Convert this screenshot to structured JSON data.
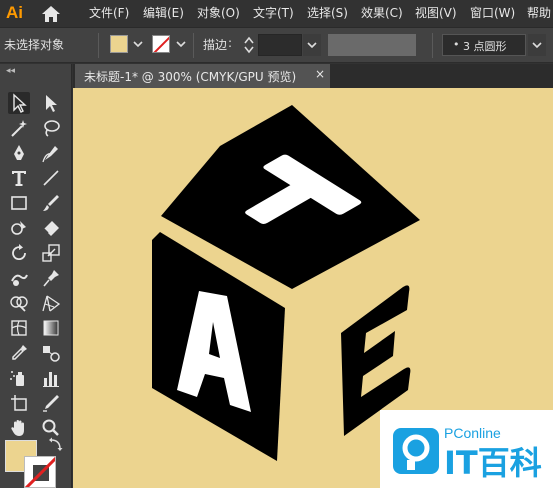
{
  "app": {
    "logo": "Ai",
    "home_icon": "home-icon"
  },
  "menu": [
    {
      "label": "文件(F)"
    },
    {
      "label": "编辑(E)"
    },
    {
      "label": "对象(O)"
    },
    {
      "label": "文字(T)"
    },
    {
      "label": "选择(S)"
    },
    {
      "label": "效果(C)"
    },
    {
      "label": "视图(V)"
    },
    {
      "label": "窗口(W)"
    },
    {
      "label": "帮助"
    }
  ],
  "control_bar": {
    "selection_status": "未选择对象",
    "fill_color": "#ecd48f",
    "stroke_label": "描边",
    "stroke_value": "",
    "brush_label": "3 点圆形"
  },
  "tools_panel": {
    "collapse_label": "◂◂",
    "fill_color": "#ecd48f",
    "stroke_color": "none"
  },
  "document": {
    "tab_title": "未标题-1* @ 300% (CMYK/GPU 预览)",
    "close_label": "×",
    "canvas_color": "#ecd48f"
  },
  "artwork": {
    "cube_color": "#000000",
    "letter_color": "#ffffff",
    "letters": {
      "top": "T",
      "left": "A",
      "right": "E"
    }
  },
  "watermark": {
    "brand_small": "PConline",
    "brand_large": "IT百科",
    "accent_color": "#1aa1e1"
  }
}
